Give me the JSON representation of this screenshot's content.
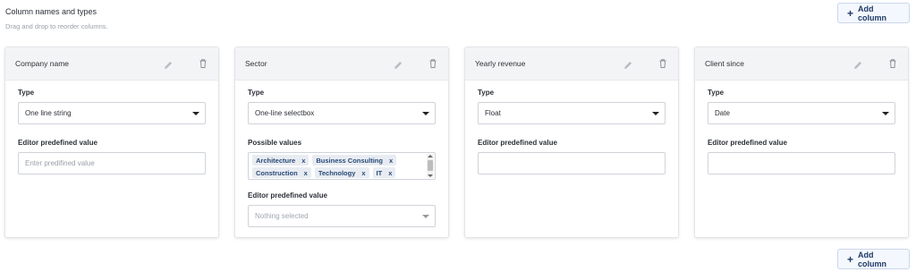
{
  "header": {
    "title": "Column names and types",
    "subtitle": "Drag and drop to reorder columns."
  },
  "add_column_label": "Add column",
  "labels": {
    "type": "Type",
    "editor_predefined": "Editor predefined value",
    "possible_values": "Possible values"
  },
  "columns": [
    {
      "name": "Company name",
      "type": "One line string",
      "predefined_placeholder": "Enter predifined value"
    },
    {
      "name": "Sector",
      "type": "One-line selectbox",
      "possible_values": [
        "Architecture",
        "Business Consulting",
        "Construction",
        "Technology",
        "IT"
      ],
      "predefined_value": "Nothing selected"
    },
    {
      "name": "Yearly revenue",
      "type": "Float",
      "predefined_value": ""
    },
    {
      "name": "Client since",
      "type": "Date",
      "predefined_value": ""
    }
  ],
  "icons": {
    "edit": "pencil-icon",
    "delete": "trash-icon",
    "add": "plus-icon"
  },
  "colors": {
    "accent": "#1e3a66",
    "card_header": "#f3f4f6",
    "tag_bg": "#e8ecf2"
  }
}
